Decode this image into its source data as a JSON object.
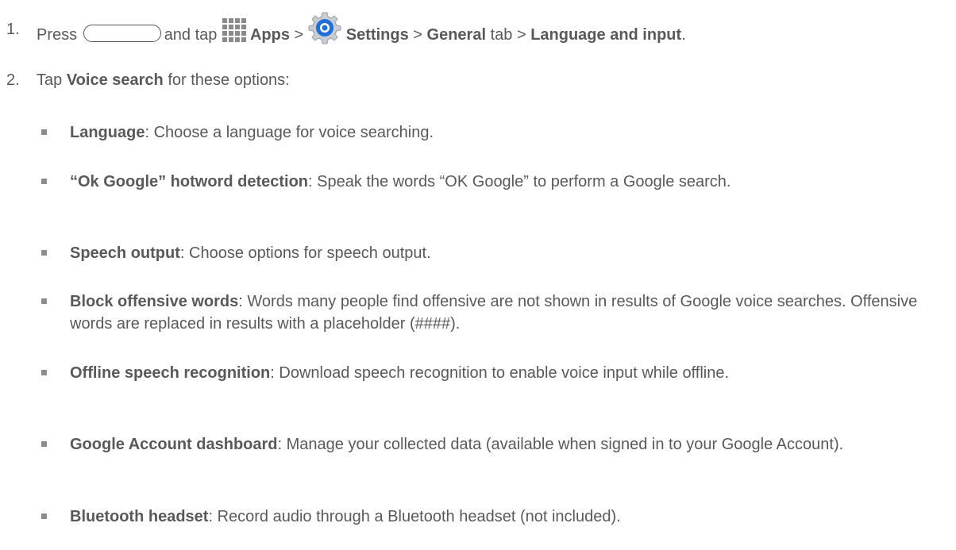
{
  "steps": {
    "s1": {
      "num": "1.",
      "press": "Press",
      "and_tap": "and tap",
      "apps": "Apps",
      "sep1": ">",
      "settings": "Settings",
      "sep2": ">",
      "general": "General",
      "tab_text": "tab",
      "sep3": ">",
      "language_and_input": "Language and input",
      "end": "."
    },
    "s2": {
      "num": "2.",
      "tap": "Tap",
      "voice_search": "Voice search",
      "rest": "for these options:"
    }
  },
  "options": [
    {
      "term": "Language",
      "desc": ": Choose a language for voice searching."
    },
    {
      "term": "“Ok Google” hotword detection",
      "desc": ": Speak the words “OK Google” to perform a Google search."
    },
    {
      "term": "Speech output",
      "desc": ": Choose options for speech output."
    },
    {
      "term": "Block offensive words",
      "desc": ": Words many people find offensive are not shown in results of Google voice searches. Offensive words are replaced in results with a placeholder (####)."
    },
    {
      "term": "Offline speech recognition",
      "desc": ": Download speech recognition to enable voice input while offline."
    },
    {
      "term": "Google Account dashboard",
      "desc": ": Manage your collected data (available when signed in to your Google Account)."
    },
    {
      "term": "Bluetooth headset",
      "desc": ": Record audio through a Bluetooth headset (not included)."
    }
  ],
  "icons": {
    "home_key": "home-key-icon",
    "apps": "apps-grid-icon",
    "settings": "settings-gear-icon"
  },
  "colors": {
    "text": "#595959",
    "bullet": "#8c8c8c",
    "gear_blue": "#1e6fd9"
  }
}
